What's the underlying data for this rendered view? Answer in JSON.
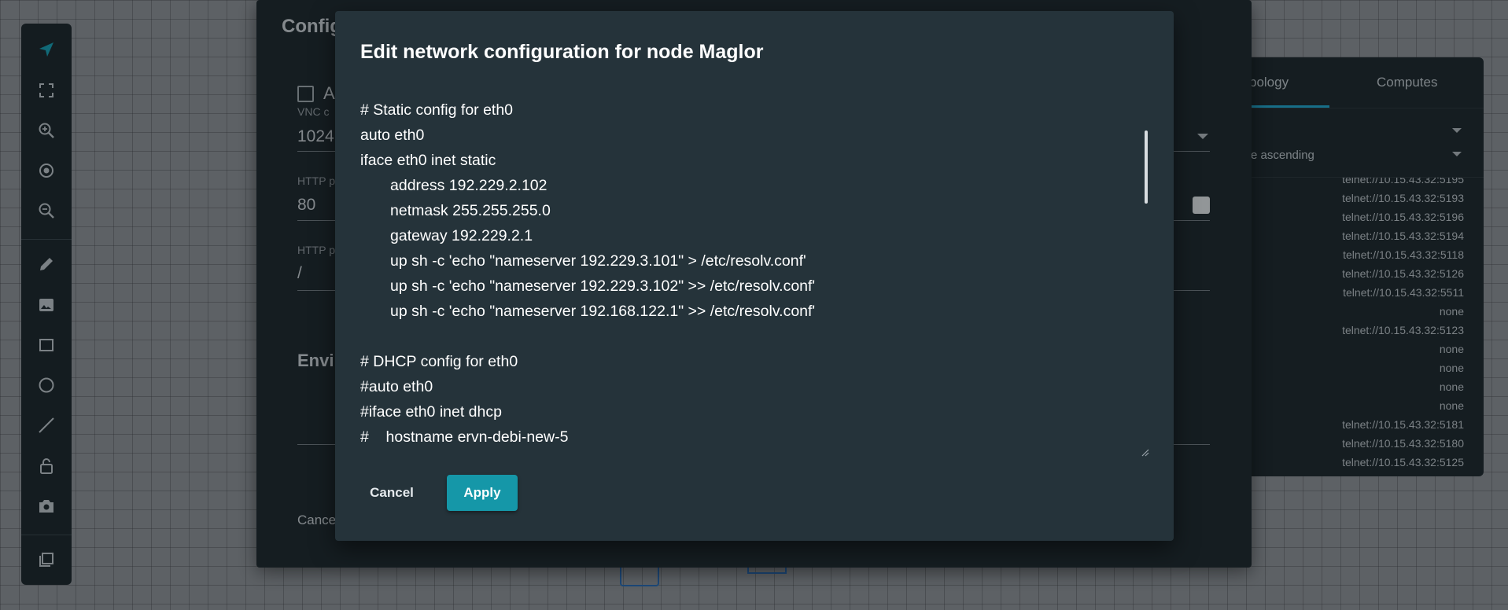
{
  "toolbar": {
    "items": [
      "select-icon",
      "fit-screen-icon",
      "zoom-in-icon",
      "center-icon",
      "zoom-out-icon",
      "pencil-icon",
      "image-icon",
      "rectangle-icon",
      "ellipse-icon",
      "line-icon",
      "lock-icon",
      "camera-icon",
      "layers-icon"
    ],
    "accent_color": "#1a9bb0"
  },
  "topology_panel": {
    "tab_topology": "pology",
    "tab_computes": "Computes",
    "sort_label": "e ascending",
    "consoles": [
      "telnet://10.15.43.32:5195",
      "telnet://10.15.43.32:5193",
      "telnet://10.15.43.32:5196",
      "telnet://10.15.43.32:5194",
      "telnet://10.15.43.32:5118",
      "telnet://10.15.43.32:5126",
      "telnet://10.15.43.32:5511",
      "none",
      "telnet://10.15.43.32:5123",
      "none",
      "none",
      "none",
      "none",
      "telnet://10.15.43.32:5181",
      "telnet://10.15.43.32:5180",
      "telnet://10.15.43.32:5125"
    ]
  },
  "back_dialog": {
    "title": "Config",
    "checkbox_label": "A",
    "vnc_label": "VNC c",
    "vnc_value": "1024",
    "http_port_label": "HTTP p",
    "http_port_value": "80",
    "http_path_label": "HTTP p",
    "http_path_value": "/",
    "env_section": "Envir",
    "cancel_label": "Cance"
  },
  "dialog": {
    "title": "Edit network configuration for node Maglor",
    "lines": [
      {
        "text": "# Static config for eth0",
        "indent": false
      },
      {
        "text": "auto eth0",
        "indent": false
      },
      {
        "text": "iface eth0 inet static",
        "indent": false
      },
      {
        "text": "address 192.229.2.102",
        "indent": true
      },
      {
        "text": "netmask 255.255.255.0",
        "indent": true
      },
      {
        "text": "gateway 192.229.2.1",
        "indent": true
      },
      {
        "text": "up sh -c 'echo \"nameserver 192.229.3.101\" > /etc/resolv.conf'",
        "indent": true
      },
      {
        "text": "up sh -c 'echo \"nameserver 192.229.3.102\" >> /etc/resolv.conf'",
        "indent": true
      },
      {
        "text": "up sh -c 'echo \"nameserver 192.168.122.1\" >> /etc/resolv.conf'",
        "indent": true
      },
      {
        "text": "",
        "indent": false
      },
      {
        "text": "# DHCP config for eth0",
        "indent": false
      },
      {
        "text": "#auto eth0",
        "indent": false
      },
      {
        "text": "#iface eth0 inet dhcp",
        "indent": false
      },
      {
        "text": "#    hostname ervn-debi-new-5",
        "indent": false
      }
    ],
    "cancel_label": "Cancel",
    "apply_label": "Apply",
    "apply_color": "#1597a8"
  }
}
